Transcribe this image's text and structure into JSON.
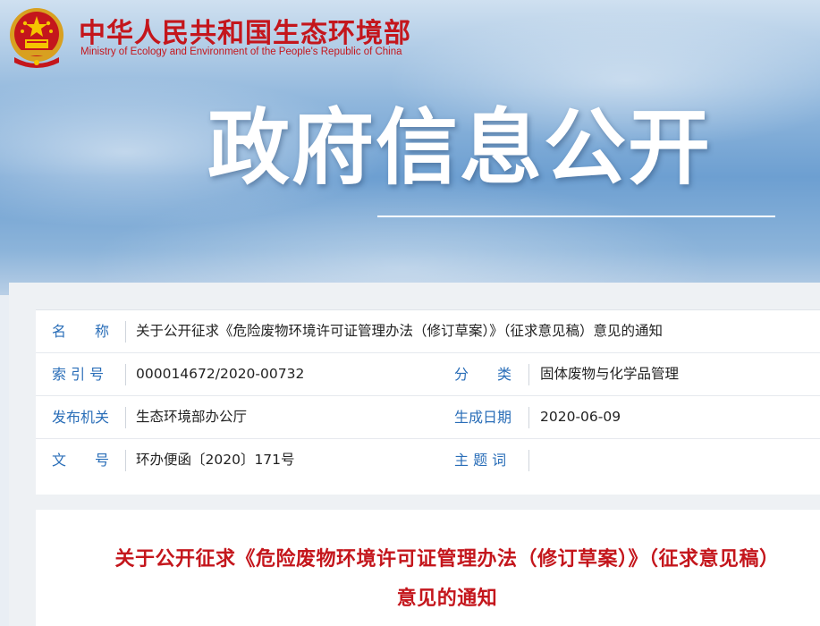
{
  "header": {
    "ministry_cn": "中华人民共和国生态环境部",
    "ministry_en": "Ministry of Ecology and Environment of the People's Republic of China",
    "emblem_icon": "national-emblem-icon",
    "hero_title": "政府信息公开"
  },
  "meta": {
    "name_label": "名　　称",
    "name_value": "关于公开征求《危险废物环境许可证管理办法（修订草案）》（征求意见稿）意见的通知",
    "index_label": "索 引 号",
    "index_value": "000014672/2020-00732",
    "category_label": "分　　类",
    "category_value": "固体废物与化学品管理",
    "issuer_label": "发布机关",
    "issuer_value": "生态环境部办公厅",
    "date_label": "生成日期",
    "date_value": "2020-06-09",
    "docno_label": "文　　号",
    "docno_value": "环办便函〔2020〕171号",
    "keywords_label": "主 题 词",
    "keywords_value": ""
  },
  "article": {
    "title": "关于公开征求《危险废物环境许可证管理办法（修订草案）》（征求意见稿）意见的通知"
  },
  "colors": {
    "brand_red": "#c4161c",
    "label_blue": "#2a6eb8"
  }
}
